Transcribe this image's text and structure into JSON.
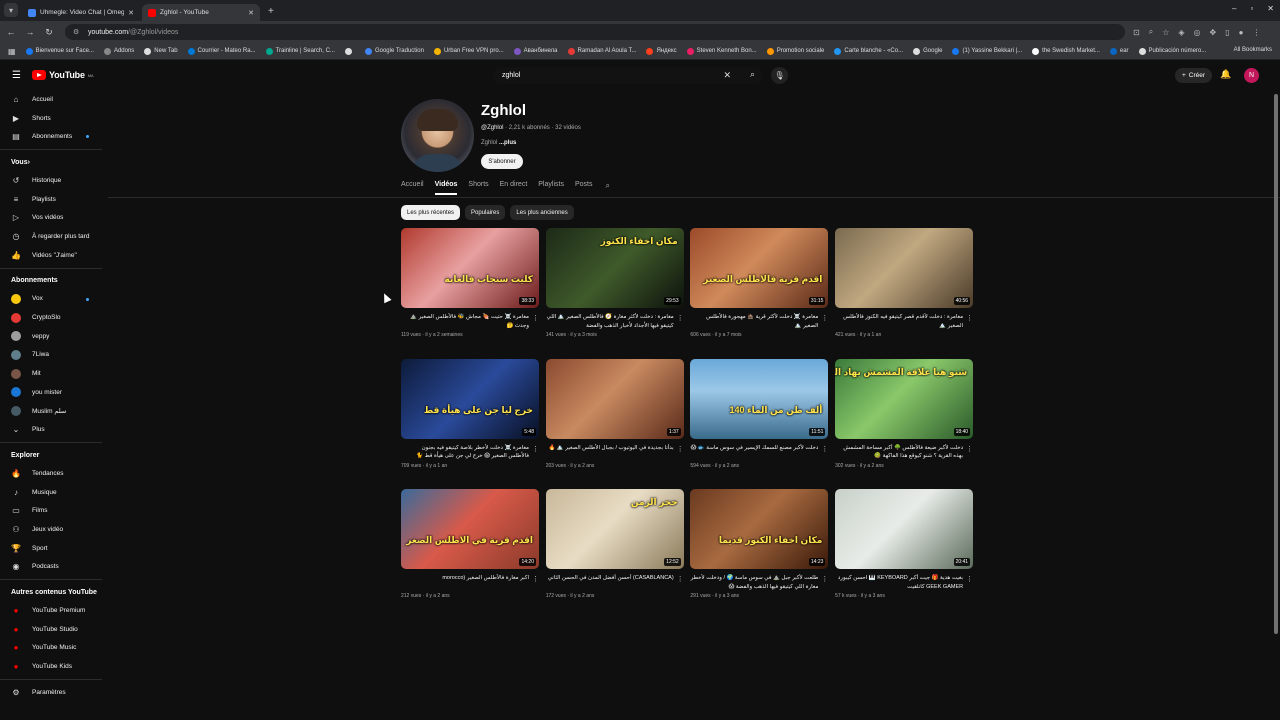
{
  "browser": {
    "tabs": [
      {
        "title": "Uhmegle: Video Chat | Omegle Alternative",
        "color": "#4285f4",
        "active": false
      },
      {
        "title": "Zghlol - YouTube",
        "color": "#ff0000",
        "active": true
      }
    ],
    "url_host": "youtube.com",
    "url_path": "/@Zghlol/videos",
    "bookmarks": [
      {
        "label": "Bienvenue sur Face...",
        "color": "#1877f2"
      },
      {
        "label": "Addons",
        "color": "#888888"
      },
      {
        "label": "New Tab",
        "color": "#dddddd"
      },
      {
        "label": "Courrier - Mateo Ra...",
        "color": "#0078d4"
      },
      {
        "label": "Trainline | Search, C...",
        "color": "#00a88f"
      },
      {
        "label": "",
        "color": "#dddddd"
      },
      {
        "label": "Google Traduction",
        "color": "#4285f4"
      },
      {
        "label": "Urban Free VPN pro...",
        "color": "#f4b400"
      },
      {
        "label": "Аванбинела",
        "color": "#7e57c2"
      },
      {
        "label": "Ramadan Al Aoula T...",
        "color": "#e53935"
      },
      {
        "label": "Яндекс",
        "color": "#fc3f1d"
      },
      {
        "label": "Steven Kenneth Bon...",
        "color": "#e91e63"
      },
      {
        "label": "Promotion sociale",
        "color": "#ff9800"
      },
      {
        "label": "Carte blanche - «Co...",
        "color": "#2196f3"
      },
      {
        "label": "Google",
        "color": "#dddddd"
      },
      {
        "label": "(1) Yassine Bekkari |...",
        "color": "#1877f2"
      },
      {
        "label": "the Swedish Market...",
        "color": "#fafafa"
      },
      {
        "label": "ear",
        "color": "#0a66c2"
      },
      {
        "label": "Publicación número...",
        "color": "#dddddd"
      }
    ],
    "all_bookmarks": "All Bookmarks"
  },
  "yt": {
    "logo_text": "YouTube",
    "logo_sup": "MA",
    "search_query": "zghlol",
    "create_label": "Créer",
    "avatar_letter": "N"
  },
  "sidebar": {
    "main": [
      {
        "label": "Accueil",
        "icon": "home-icon",
        "glyph": "⌂"
      },
      {
        "label": "Shorts",
        "icon": "shorts-icon",
        "glyph": "▶"
      },
      {
        "label": "Abonnements",
        "icon": "subscriptions-icon",
        "glyph": "▤",
        "live": true
      }
    ],
    "you_title": "Vous",
    "you": [
      {
        "label": "Historique",
        "icon": "history-icon",
        "glyph": "↺"
      },
      {
        "label": "Playlists",
        "icon": "playlists-icon",
        "glyph": "≡"
      },
      {
        "label": "Vos vidéos",
        "icon": "your-videos-icon",
        "glyph": "▷"
      },
      {
        "label": "À regarder plus tard",
        "icon": "watch-later-icon",
        "glyph": "◷"
      },
      {
        "label": "Vidéos \"J'aime\"",
        "icon": "liked-icon",
        "glyph": "👍"
      }
    ],
    "subs_title": "Abonnements",
    "subs": [
      {
        "label": "Vox",
        "color": "#f9c80e",
        "live": true
      },
      {
        "label": "CryptoSlo",
        "color": "#e53935"
      },
      {
        "label": "veppy",
        "color": "#9e9e9e"
      },
      {
        "label": "7Liwa",
        "color": "#607d8b"
      },
      {
        "label": "Mit",
        "color": "#795548"
      },
      {
        "label": "you mister",
        "color": "#1976d2"
      },
      {
        "label": "Muslim سلم",
        "color": "#455a64"
      }
    ],
    "more_label": "Plus",
    "explore_title": "Explorer",
    "explore": [
      {
        "label": "Tendances",
        "icon": "trending-icon",
        "glyph": "🔥"
      },
      {
        "label": "Musique",
        "icon": "music-icon",
        "glyph": "♪"
      },
      {
        "label": "Films",
        "icon": "films-icon",
        "glyph": "▭"
      },
      {
        "label": "Jeux vidéo",
        "icon": "gaming-icon",
        "glyph": "⚇"
      },
      {
        "label": "Sport",
        "icon": "sport-icon",
        "glyph": "🏆"
      },
      {
        "label": "Podcasts",
        "icon": "podcasts-icon",
        "glyph": "◉"
      }
    ],
    "other_title": "Autres contenus YouTube",
    "other": [
      {
        "label": "YouTube Premium"
      },
      {
        "label": "YouTube Studio"
      },
      {
        "label": "YouTube Music"
      },
      {
        "label": "YouTube Kids"
      }
    ],
    "settings_label": "Paramètres"
  },
  "channel": {
    "name": "Zghlol",
    "handle": "@Zghlol",
    "stats": "· 2,21 k abonnés · 32 vidéos",
    "desc": "Zghlol",
    "desc_more": "...plus",
    "subscribe_label": "S'abonner",
    "tabs": [
      "Accueil",
      "Vidéos",
      "Shorts",
      "En direct",
      "Playlists",
      "Posts"
    ],
    "active_tab": "Vidéos",
    "chips": [
      "Les plus récentes",
      "Populaires",
      "Les plus anciennes"
    ]
  },
  "videos": [
    {
      "title": "مغامرة ☠️ حتيت 🍖 مجاش 🐝 فالأطلس الصغير ⛰️ وجدت 🤔",
      "meta": "119 vues · il y a 2 semaines",
      "duration": "38:33",
      "overlay": "كليت سنجاب فالغابة",
      "bg": "linear-gradient(135deg,#b03a2e,#e8a0a0 45%,#6b1b1b)",
      "rtl": true
    },
    {
      "title": "مغامرة : دخلت لأكثر مغارة 🧭 فالأطلس الصغير 🏔️ اللي كيتيقو فيها الأجداد لأخبار الذهب والفضة",
      "meta": "141 vues · il y a 3 mois",
      "duration": "29:53",
      "overlay": "مكان اخفاء الكنوز",
      "bg": "linear-gradient(135deg,#1d2a18,#3f5a2a 50%,#0d120c)",
      "rtl": true
    },
    {
      "title": "مغامرة ☠️ دخلت لأكثر قرية 🏚️ مهجورة فالأطلس الصغير 🏔️",
      "meta": "606 vues · il y a 7 mois",
      "duration": "31:15",
      "overlay": "اقدم قرية فالاطلس الصغير",
      "bg": "linear-gradient(135deg,#9b4a2a,#d08a5a 45%,#5a2a18)",
      "rtl": true
    },
    {
      "title": "مغامرة : دخلت لأقدم قصر كيتيقو فيه الكنوز فالأطلس الصغير 🏔️",
      "meta": "421 vues · il y a 1 an",
      "duration": "40:56",
      "overlay": "",
      "bg": "linear-gradient(135deg,#7a6a50,#c0a880 45%,#4a3a28)",
      "rtl": true
    },
    {
      "title": "مغامرة ☠️ دخلت لأخطر بلاصة كيتيقو فيه بجنون فالأطلس الصغير 😱 خرج لي جن على هيأة قط 🐈",
      "meta": "709 vues · il y a 1 an",
      "duration": "5:48",
      "overlay": "خرج ليا جن على هيأة قط",
      "bg": "linear-gradient(135deg,#0d1b3a,#2a4a9a 50%,#080f22)",
      "rtl": true
    },
    {
      "title": "بدأنا بجديدة في اليوتيوب / بجبال الأطلس الصغير 🏔️ 🔥",
      "meta": "203 vues · il y a 2 ans",
      "duration": "1:37",
      "overlay": "",
      "bg": "linear-gradient(135deg,#8a4a30,#c88a60 45%,#5a2a1a)",
      "rtl": true
    },
    {
      "title": "دخلت لأكبر مصنع للسمك الإيسير في سوس ماسة 🐟 😱",
      "meta": "594 vues · il y a 2 ans",
      "duration": "11:51",
      "overlay": "140 ألف طن من الماء",
      "bg": "linear-gradient(180deg,#6aa8d8,#9cc8e8 40%,#3a6a8a)",
      "rtl": true
    },
    {
      "title": "دخلت لأكبر ضيعة فالأطلس 🌳 أكبر مساحة المشمش بهذه القرية ؟ شنو كيوقع هذا الفاكهة 🥝",
      "meta": "302 vues · il y a 2 ans",
      "duration": "18:40",
      "overlay": "شنو هيا علاقة المشمش بهاد الفاكية",
      "bg": "linear-gradient(135deg,#3a7a3a,#8ac86a 45%,#2a5a2a)",
      "rtl": true
    },
    {
      "title": "اكبر مغارة فالأطلس الصغير (morocco",
      "meta": "212 vues · il y a 2 ans",
      "duration": "14:20",
      "overlay": "اقدم قرية في الاطلس الصغر",
      "bg": "linear-gradient(135deg,#3a6a9a,#d85a4a 45%,#8a3a2a)",
      "rtl": true
    },
    {
      "title": "(CASABLANCA) أحسن أفضل المدن في الحسن الثاني",
      "meta": "172 vues · il y a 2 ans",
      "duration": "12:52",
      "overlay": "حجر الزمن",
      "bg": "linear-gradient(135deg,#c8b89a,#e8dcc4 45%,#8a7a5a)",
      "rtl": true
    },
    {
      "title": "طلعت لأكبر جبل ⛰️ في سوس ماسة 🌍 / ودخلت لأخطر مغارة اللي كيتيقو فيها الذهب والفضة 😱",
      "meta": "291 vues · il y a 3 ans",
      "duration": "14:23",
      "overlay": "مكان اخفاء الكنوز قديما",
      "bg": "linear-gradient(135deg,#6a3a20,#a86a40 45%,#3a1a0a)",
      "rtl": true
    },
    {
      "title": "بغيت هدية 🎁 جيت أكبر KEYBOARD 🎹 احسن كيبورد GEEK GAMER كانلقيت",
      "meta": "57 k vues · il y a 3 ans",
      "duration": "20:41",
      "overlay": "",
      "bg": "linear-gradient(135deg,#c8d0c8,#e8ece8 45%,#5a6a5a)",
      "rtl": true
    }
  ]
}
